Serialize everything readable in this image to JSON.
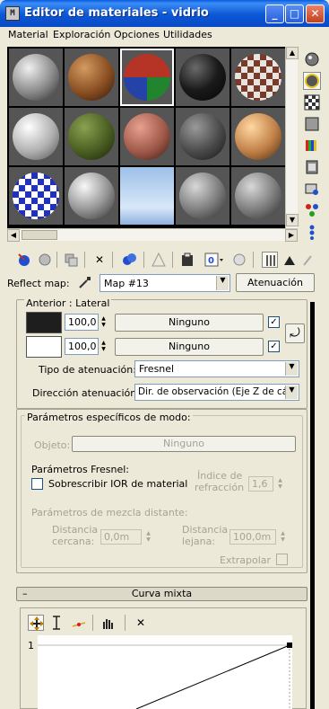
{
  "window": {
    "title": "Editor de materiales - vidrio",
    "controls": {
      "minimize": "_",
      "maximize": "□",
      "close": "✕"
    }
  },
  "menu": [
    "Material",
    "Exploración",
    "Opciones",
    "Utilidades"
  ],
  "slots": [
    {
      "style": "grey"
    },
    {
      "style": "wood"
    },
    {
      "style": "checker-rgb"
    },
    {
      "style": "black"
    },
    {
      "style": "checker-brown"
    },
    {
      "style": "light-grey"
    },
    {
      "style": "moss"
    },
    {
      "style": "terracotta"
    },
    {
      "style": "granite"
    },
    {
      "style": "tan"
    },
    {
      "style": "checker-blue"
    },
    {
      "style": "silver"
    },
    {
      "style": "sky"
    },
    {
      "style": "grey"
    },
    {
      "style": "grey"
    }
  ],
  "reflect": {
    "label": "Reflect map:",
    "map_name": "Map #13",
    "button": "Atenuación"
  },
  "falloff": {
    "group_title": "Anterior : Lateral",
    "front_value": "100,0",
    "side_value": "100,0",
    "front_map": "Ninguno",
    "side_map": "Ninguno",
    "type_label": "Tipo de atenuación:",
    "type_value": "Fresnel",
    "direction_label": "Dirección atenuación:",
    "direction_value": "Dir. de observación (Eje Z de cám",
    "swap_icon": "swap-icon"
  },
  "mode": {
    "title": "Parámetros específicos de modo:",
    "object_label": "Objeto:",
    "object_button": "Ninguno",
    "fresnel_title": "Parámetros Fresnel:",
    "override_label": "Sobrescribir IOR de material",
    "ior_label_1": "Índice de",
    "ior_label_2": "refracción",
    "ior_value": "1,6",
    "distance_title": "Parámetros de mezcla distante:",
    "near_label_1": "Distancia",
    "near_label_2": "cercana:",
    "near_value": "0,0m",
    "far_label_1": "Distancia",
    "far_label_2": "lejana:",
    "far_value": "100,0m",
    "extrapolate_label": "Extrapolar"
  },
  "curve": {
    "rollout_title": "Curva mixta",
    "collapse": "–",
    "axis_label": "1"
  }
}
